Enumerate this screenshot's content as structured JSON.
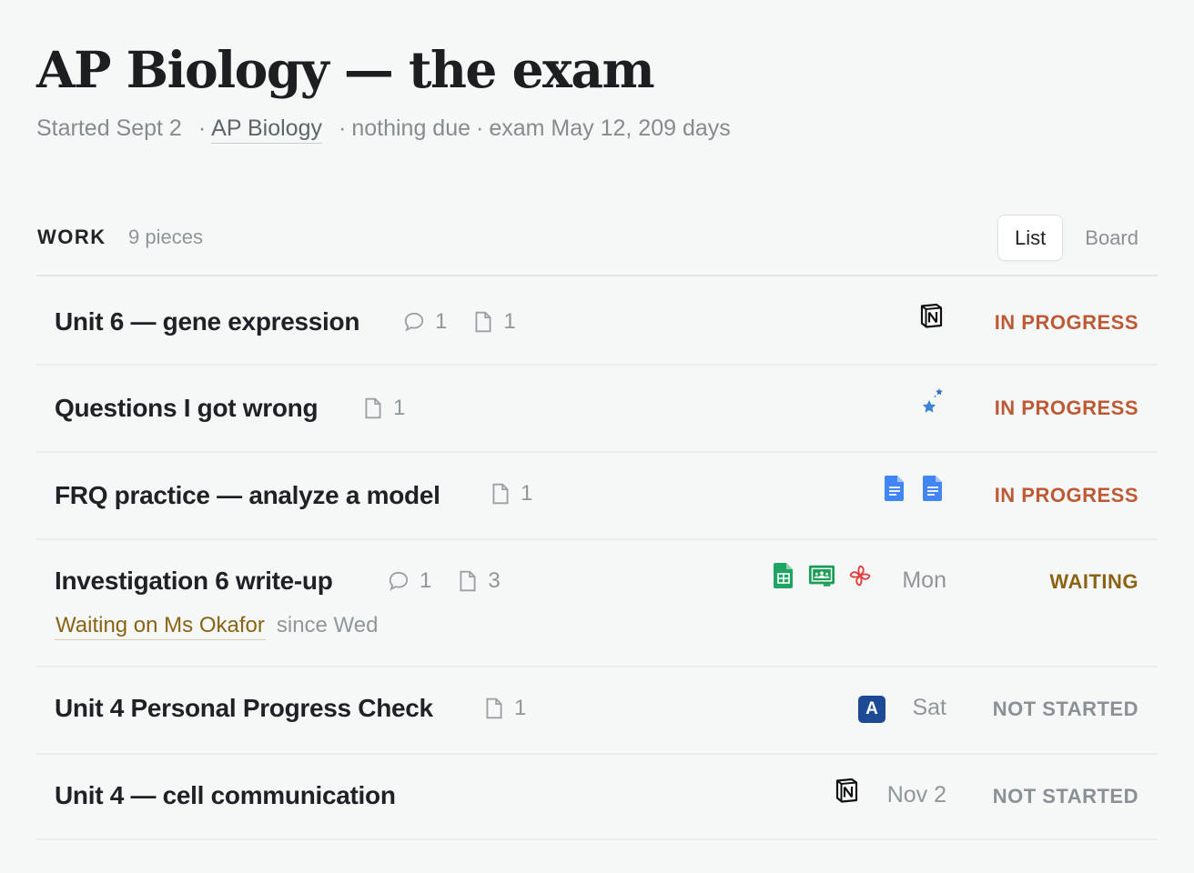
{
  "header": {
    "title": "AP Biology — the exam",
    "started": "Started Sept 2",
    "course": "AP Biology",
    "due_note": "nothing due",
    "exam_note": "exam May 12, 209 days",
    "separator": "·"
  },
  "work": {
    "label": "WORK",
    "count": "9 pieces",
    "views": [
      "List",
      "Board"
    ],
    "active_view": "List"
  },
  "colors": {
    "in_progress": "#bd5a35",
    "waiting": "#8a6414",
    "not_started": "#8a9196",
    "background": "#f6f7f7"
  },
  "rows": [
    {
      "title": "Unit 6 — gene expression",
      "comments": "1",
      "files": "1",
      "tools": [
        "notion-icon"
      ],
      "due": "",
      "status": "IN PROGRESS"
    },
    {
      "title": "Questions I got wrong",
      "files": "1",
      "tools": [
        "sparkle-stars-icon"
      ],
      "due": "",
      "status": "IN PROGRESS"
    },
    {
      "title": "FRQ practice — analyze a model",
      "files": "1",
      "tools": [
        "google-docs-icon",
        "google-docs-icon"
      ],
      "due": "",
      "status": "IN PROGRESS"
    },
    {
      "title": "Investigation 6 write-up",
      "comments": "1",
      "files": "3",
      "tools": [
        "google-sheets-icon",
        "google-classroom-icon",
        "pinwheel-icon"
      ],
      "due": "Mon",
      "status": "WAITING",
      "waiting_on": "Waiting on Ms Okafor",
      "since": "since Wed"
    },
    {
      "title": "Unit 4 Personal Progress Check",
      "files": "1",
      "tools": [
        "ap-classroom-icon"
      ],
      "ap_badge": "A",
      "due": "Sat",
      "status": "NOT STARTED"
    },
    {
      "title": "Unit 4 — cell communication",
      "tools": [
        "notion-icon"
      ],
      "due": "Nov 2",
      "status": "NOT STARTED"
    }
  ]
}
